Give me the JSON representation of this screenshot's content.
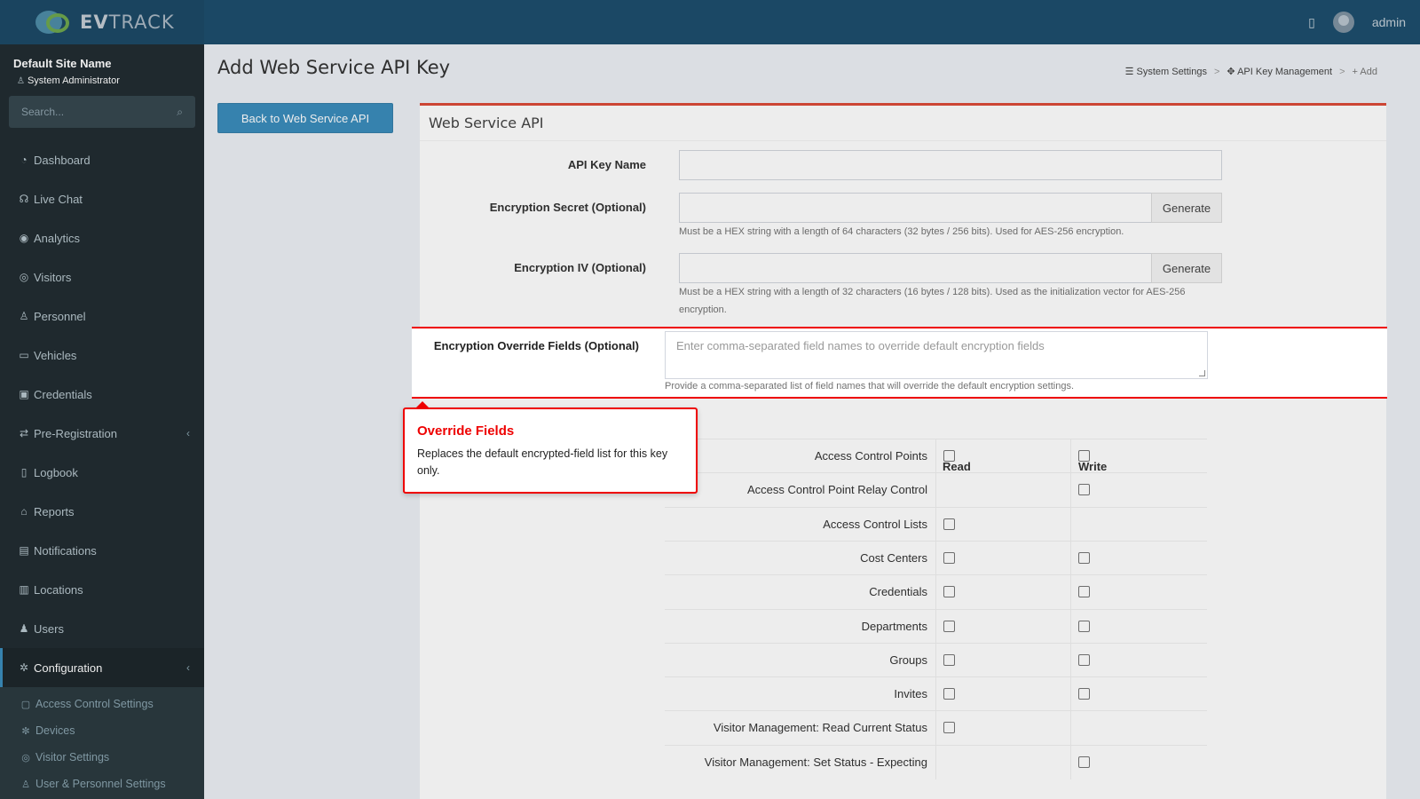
{
  "app": {
    "logo_text_bold": "EV",
    "logo_text": "TRACK",
    "user_name": "admin"
  },
  "sidebar": {
    "site_name": "Default Site Name",
    "role": "System Administrator",
    "search_placeholder": "Search...",
    "items": [
      {
        "label": "Dashboard",
        "icon": "dashboard-icon",
        "glyph": "◔"
      },
      {
        "label": "Live Chat",
        "icon": "headset-icon",
        "glyph": "☊"
      },
      {
        "label": "Analytics",
        "icon": "target-icon",
        "glyph": "◉"
      },
      {
        "label": "Visitors",
        "icon": "eye-icon",
        "glyph": "◎"
      },
      {
        "label": "Personnel",
        "icon": "person-icon",
        "glyph": "♙"
      },
      {
        "label": "Vehicles",
        "icon": "car-icon",
        "glyph": "▭"
      },
      {
        "label": "Credentials",
        "icon": "badge-icon",
        "glyph": "▣"
      },
      {
        "label": "Pre-Registration",
        "icon": "arrows-icon",
        "glyph": "⇄"
      },
      {
        "label": "Logbook",
        "icon": "book-icon",
        "glyph": "▯"
      },
      {
        "label": "Reports",
        "icon": "chart-icon",
        "glyph": "⌂"
      },
      {
        "label": "Notifications",
        "icon": "message-icon",
        "glyph": "▤"
      },
      {
        "label": "Locations",
        "icon": "building-icon",
        "glyph": "▥"
      },
      {
        "label": "Users",
        "icon": "users-icon",
        "glyph": "♟"
      },
      {
        "label": "Configuration",
        "icon": "gear-icon",
        "glyph": "✲"
      }
    ],
    "submenu": [
      {
        "label": "Access Control Settings",
        "icon": "lock-icon",
        "glyph": "▢"
      },
      {
        "label": "Devices",
        "icon": "cog-icon",
        "glyph": "✼"
      },
      {
        "label": "Visitor Settings",
        "icon": "eye-icon",
        "glyph": "◎"
      },
      {
        "label": "User & Personnel Settings",
        "icon": "user-icon",
        "glyph": "♙"
      }
    ]
  },
  "page": {
    "title": "Add Web Service API Key",
    "breadcrumb": [
      "System Settings",
      "API Key Management",
      "Add"
    ],
    "back_button": "Back to Web Service API",
    "box_title": "Web Service API"
  },
  "form": {
    "api_key_name_label": "API Key Name",
    "api_key_name_value": "",
    "secret_label": "Encryption Secret (Optional)",
    "secret_value": "",
    "secret_help": "Must be a HEX string with a length of 64 characters (32 bytes / 256 bits). Used for AES-256 encryption.",
    "iv_label": "Encryption IV (Optional)",
    "iv_value": "",
    "iv_help": "Must be a HEX string with a length of 32 characters (16 bytes / 128 bits). Used as the initialization vector for AES-256 encryption.",
    "generate_label": "Generate",
    "override_label": "Encryption Override Fields (Optional)",
    "override_placeholder": "Enter comma-separated field names to override default encryption fields",
    "override_help": "Provide a comma-separated list of field names that will override the default encryption settings."
  },
  "callout": {
    "title": "Override Fields",
    "body": "Replaces the default encrypted-field list for this key only."
  },
  "permissions": {
    "read_header": "Read",
    "write_header": "Write",
    "rows": [
      {
        "name": "Access Control Points",
        "read": true,
        "write": true
      },
      {
        "name": "Access Control Point Relay Control",
        "read": false,
        "write": true
      },
      {
        "name": "Access Control Lists",
        "read": true,
        "write": false
      },
      {
        "name": "Cost Centers",
        "read": true,
        "write": true
      },
      {
        "name": "Credentials",
        "read": true,
        "write": true
      },
      {
        "name": "Departments",
        "read": true,
        "write": true
      },
      {
        "name": "Groups",
        "read": true,
        "write": true
      },
      {
        "name": "Invites",
        "read": true,
        "write": true
      },
      {
        "name": "Visitor Management: Read Current Status",
        "read": true,
        "write": false
      },
      {
        "name": "Visitor Management: Set Status - Expecting",
        "read": false,
        "write": true
      }
    ]
  },
  "colors": {
    "accent": "#3c8dbc",
    "box_border": "#dd4b39",
    "highlight": "#e00000"
  }
}
